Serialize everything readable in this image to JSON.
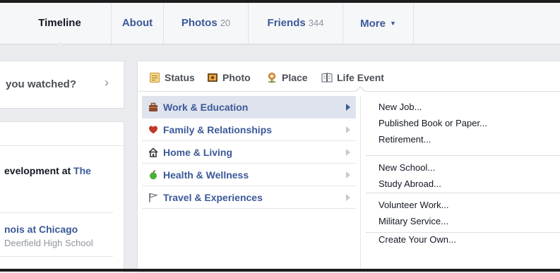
{
  "nav": {
    "tabs": [
      {
        "label": "Timeline",
        "count": ""
      },
      {
        "label": "About",
        "count": ""
      },
      {
        "label": "Photos",
        "count": "20"
      },
      {
        "label": "Friends",
        "count": "344"
      },
      {
        "label": "More",
        "count": ""
      }
    ],
    "more_caret": "▼"
  },
  "left": {
    "question": "you watched?",
    "question_chevron": "›",
    "entry1_prefix": "evelopment at ",
    "entry1_link": "The",
    "entry2": "nois at Chicago",
    "entry3": "Deerfield High School"
  },
  "composer": {
    "tabs": [
      "Status",
      "Photo",
      "Place",
      "Life Event"
    ]
  },
  "categories": [
    {
      "label": "Work & Education",
      "icon": "briefcase-icon"
    },
    {
      "label": "Family & Relationships",
      "icon": "heart-icon"
    },
    {
      "label": "Home & Living",
      "icon": "house-icon"
    },
    {
      "label": "Health & Wellness",
      "icon": "apple-icon"
    },
    {
      "label": "Travel & Experiences",
      "icon": "flag-icon"
    }
  ],
  "sub_options": {
    "group1": [
      "New Job...",
      "Published Book or Paper...",
      "Retirement..."
    ],
    "group2": [
      "New School...",
      "Study Abroad..."
    ],
    "group3": [
      "Volunteer Work...",
      "Military Service..."
    ],
    "last": "Create Your Own..."
  },
  "colors": {
    "link_blue": "#3b5998",
    "selected_bg": "#dfe3ee",
    "page_bg": "#e9ebee"
  }
}
